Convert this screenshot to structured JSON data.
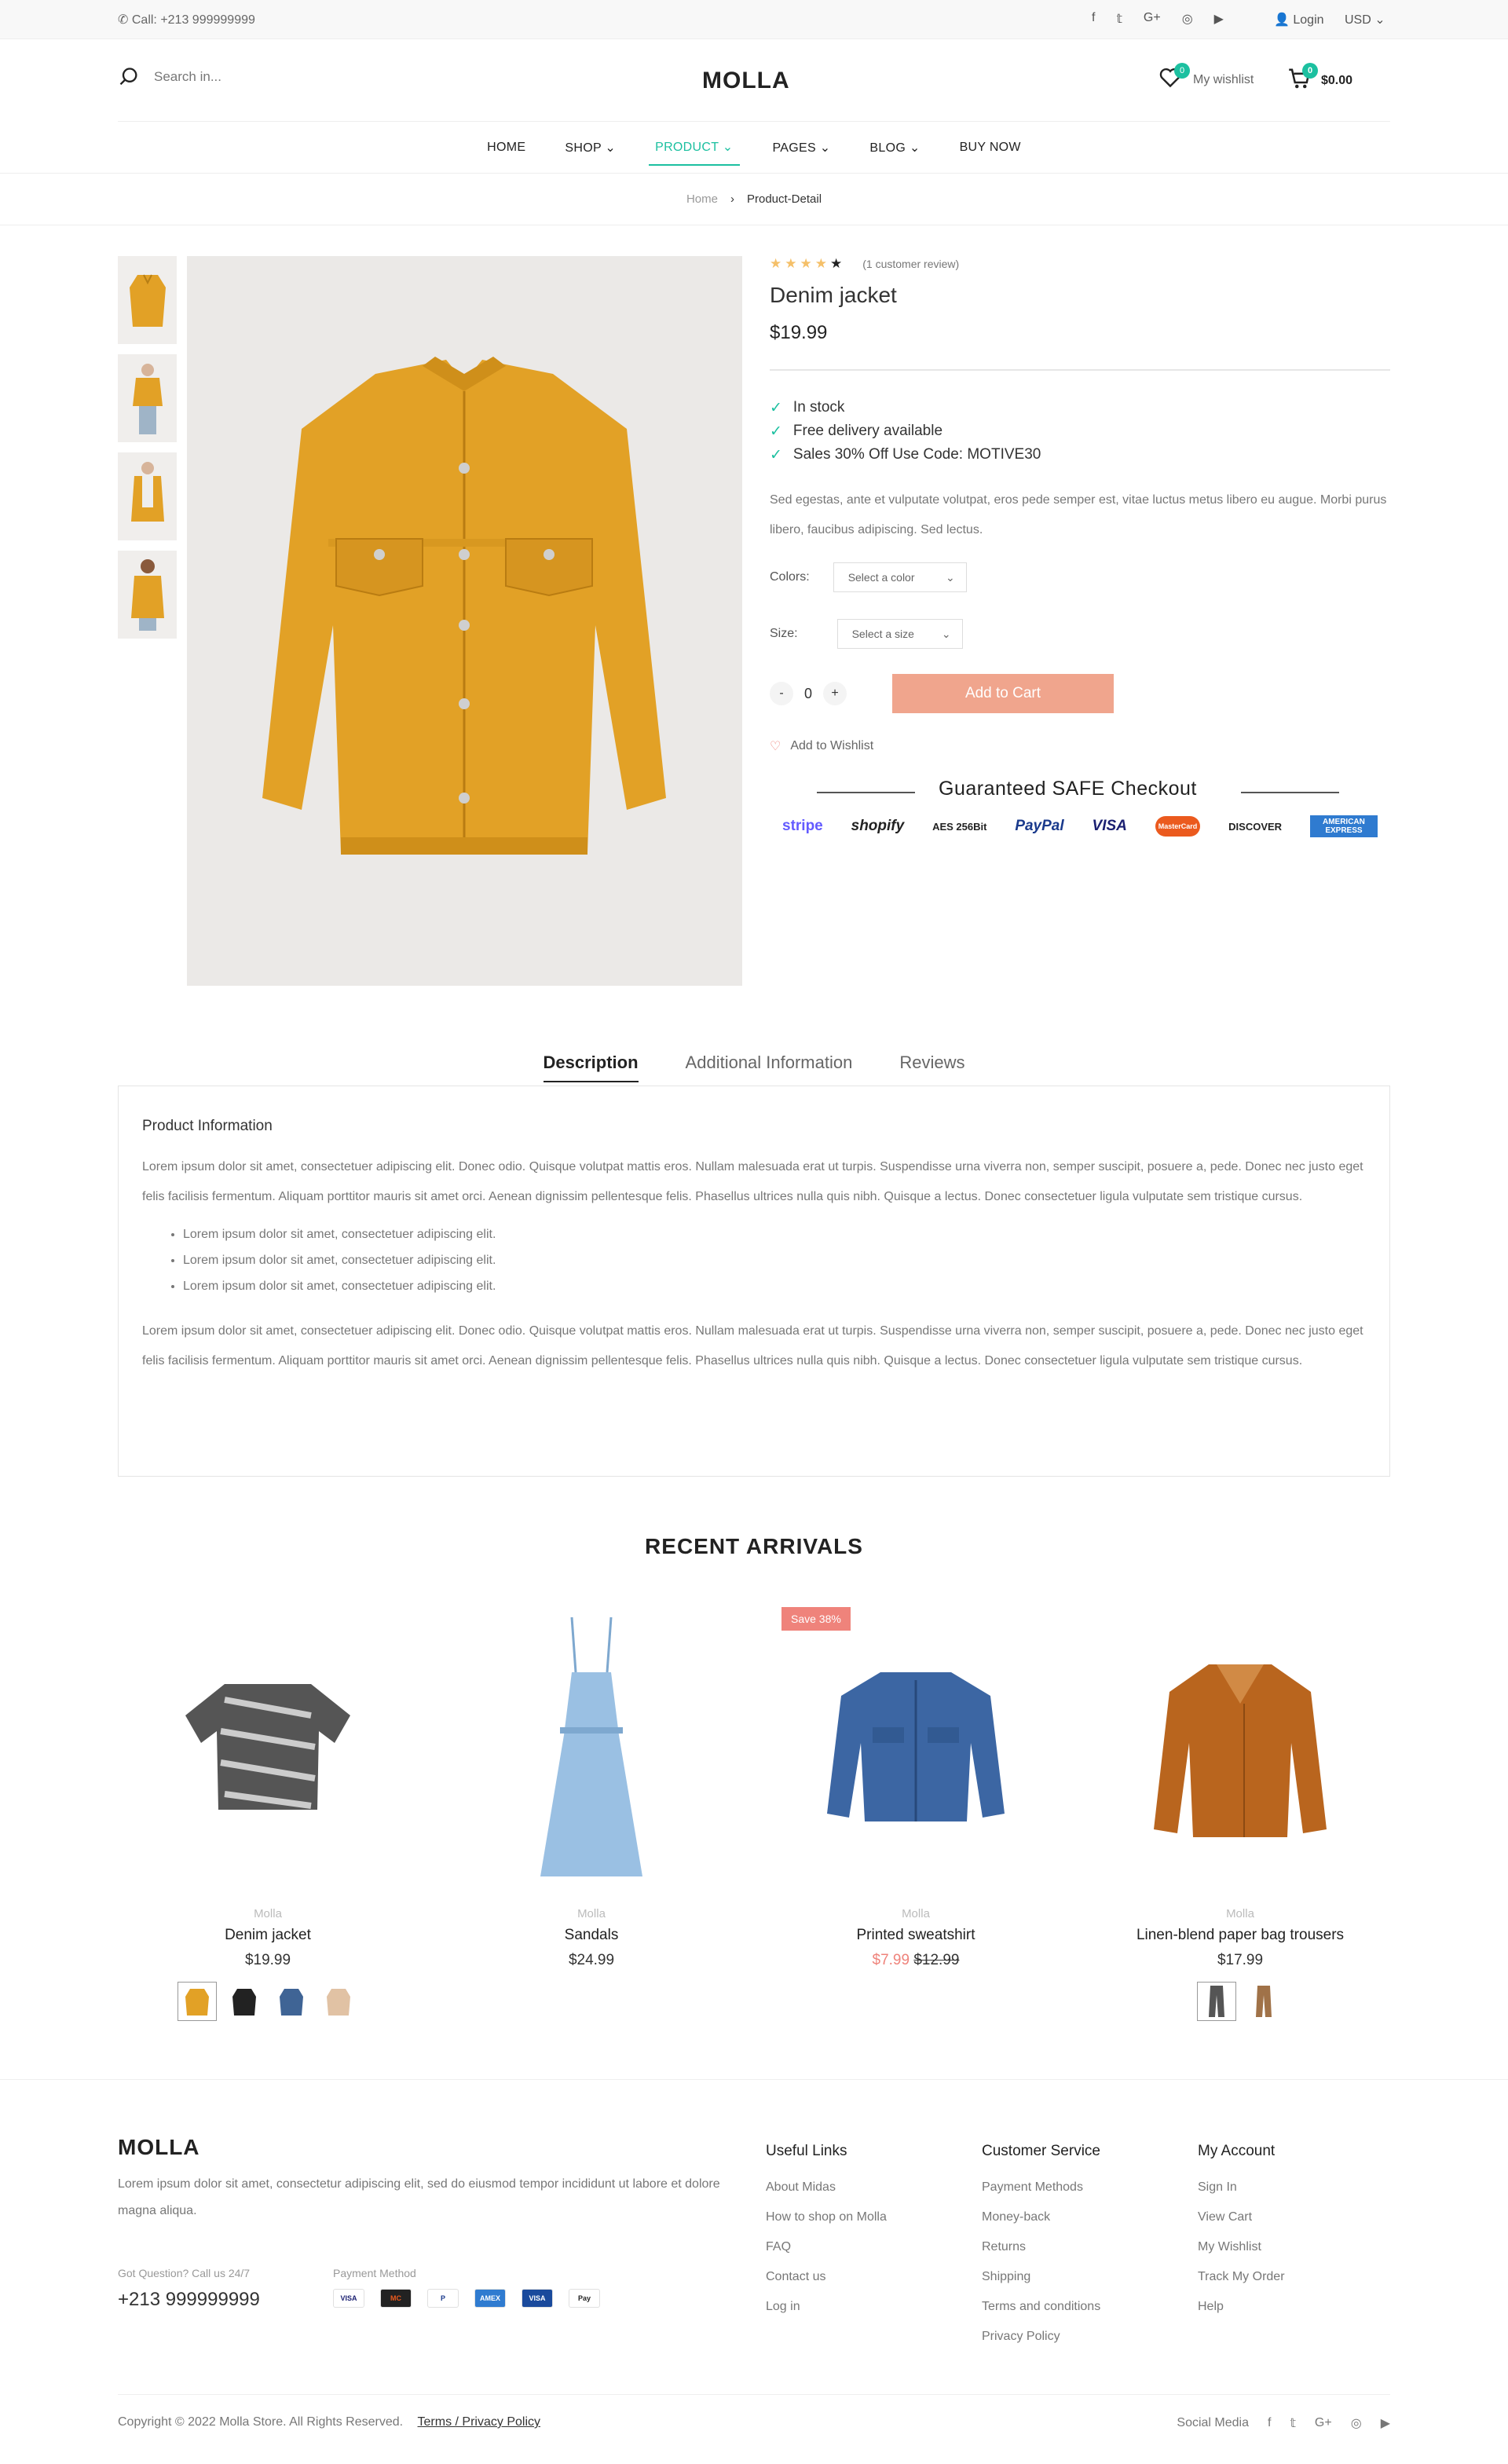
{
  "topbar": {
    "call": "Call: +213 999999999",
    "login": "Login",
    "currency": "USD"
  },
  "header": {
    "search_placeholder": "Search in...",
    "logo": "MOLLA",
    "wishlist_label": "My wishlist",
    "wishlist_count": "0",
    "cart_count": "0",
    "cart_total": "$0.00"
  },
  "nav": [
    "HOME",
    "SHOP",
    "PRODUCT",
    "PAGES",
    "BLOG",
    "BUY NOW"
  ],
  "breadcrumb": {
    "home": "Home",
    "current": "Product-Detail"
  },
  "product": {
    "review_text": "(1 customer review)",
    "rating": 4,
    "title": "Denim jacket",
    "price": "$19.99",
    "checks": [
      "In stock",
      "Free delivery available",
      "Sales 30% Off Use Code: MOTIVE30"
    ],
    "description": "Sed egestas, ante et vulputate volutpat, eros pede semper est, vitae luctus metus libero eu augue. Morbi purus libero, faucibus adipiscing. Sed lectus.",
    "colors_label": "Colors:",
    "color_placeholder": "Select a color",
    "size_label": "Size:",
    "size_placeholder": "Select a size",
    "qty_minus": "-",
    "qty_plus": "+",
    "qty": "0",
    "add_to_cart": "Add to Cart",
    "add_to_wishlist": "Add to Wishlist",
    "safe_checkout": "Guaranteed SAFE Checkout",
    "payment_logos": [
      "stripe",
      "shopify",
      "AES 256Bit",
      "PayPal",
      "VISA",
      "MasterCard",
      "DISCOVER",
      "AMERICAN EXPRESS"
    ]
  },
  "tabs": [
    "Description",
    "Additional Information",
    "Reviews"
  ],
  "tab_content": {
    "heading": "Product Information",
    "para1": "Lorem ipsum dolor sit amet, consectetuer adipiscing elit. Donec odio. Quisque volutpat mattis eros. Nullam malesuada erat ut turpis. Suspendisse urna viverra non, semper suscipit, posuere a, pede. Donec nec justo eget felis facilisis fermentum. Aliquam porttitor mauris sit amet orci. Aenean dignissim pellentesque felis. Phasellus ultrices nulla quis nibh. Quisque a lectus. Donec consectetuer ligula vulputate sem tristique cursus.",
    "bullets": [
      "Lorem ipsum dolor sit amet, consectetuer adipiscing elit.",
      "Lorem ipsum dolor sit amet, consectetuer adipiscing elit.",
      "Lorem ipsum dolor sit amet, consectetuer adipiscing elit."
    ],
    "para2": "Lorem ipsum dolor sit amet, consectetuer adipiscing elit. Donec odio. Quisque volutpat mattis eros. Nullam malesuada erat ut turpis. Suspendisse urna viverra non, semper suscipit, posuere a, pede. Donec nec justo eget felis facilisis fermentum. Aliquam porttitor mauris sit amet orci. Aenean dignissim pellentesque felis. Phasellus ultrices nulla quis nibh. Quisque a lectus. Donec consectetuer ligula vulputate sem tristique cursus."
  },
  "recent": {
    "title": "RECENT ARRIVALS",
    "items": [
      {
        "brand": "Molla",
        "name": "Denim jacket",
        "price": "$19.99"
      },
      {
        "brand": "Molla",
        "name": "Sandals",
        "price": "$24.99"
      },
      {
        "brand": "Molla",
        "name": "Printed sweatshirt",
        "sale_price": "$7.99",
        "old_price": "$12.99",
        "badge": "Save 38%"
      },
      {
        "brand": "Molla",
        "name": "Linen-blend paper bag trousers",
        "price": "$17.99"
      }
    ]
  },
  "footer": {
    "logo": "MOLLA",
    "about": "Lorem ipsum dolor sit amet, consectetur adipiscing elit, sed do eiusmod tempor incididunt ut labore et dolore magna aliqua.",
    "question": "Got Question? Call us 24/7",
    "phone": "+213 999999999",
    "payment_label": "Payment Method",
    "payment_icons": [
      "VISA",
      "MC",
      "P",
      "AMEX",
      "VISA",
      "Pay"
    ],
    "useful": {
      "title": "Useful Links",
      "links": [
        "About Midas",
        "How to shop on Molla",
        "FAQ",
        "Contact us",
        "Log in"
      ]
    },
    "service": {
      "title": "Customer Service",
      "links": [
        "Payment Methods",
        "Money-back",
        "Returns",
        "Shipping",
        "Terms and conditions",
        "Privacy Policy"
      ]
    },
    "account": {
      "title": "My Account",
      "links": [
        "Sign In",
        "View Cart",
        "My Wishlist",
        "Track My Order",
        "Help"
      ]
    },
    "copyright": "Copyright © 2022 Molla Store. All Rights Reserved.",
    "terms": "Terms / Privacy Policy",
    "social_label": "Social Media"
  },
  "colors": {
    "accent": "#1cc0a0",
    "cart_button": "#f0a58d",
    "sale": "#ef837b",
    "jacket": "#e2a126"
  }
}
